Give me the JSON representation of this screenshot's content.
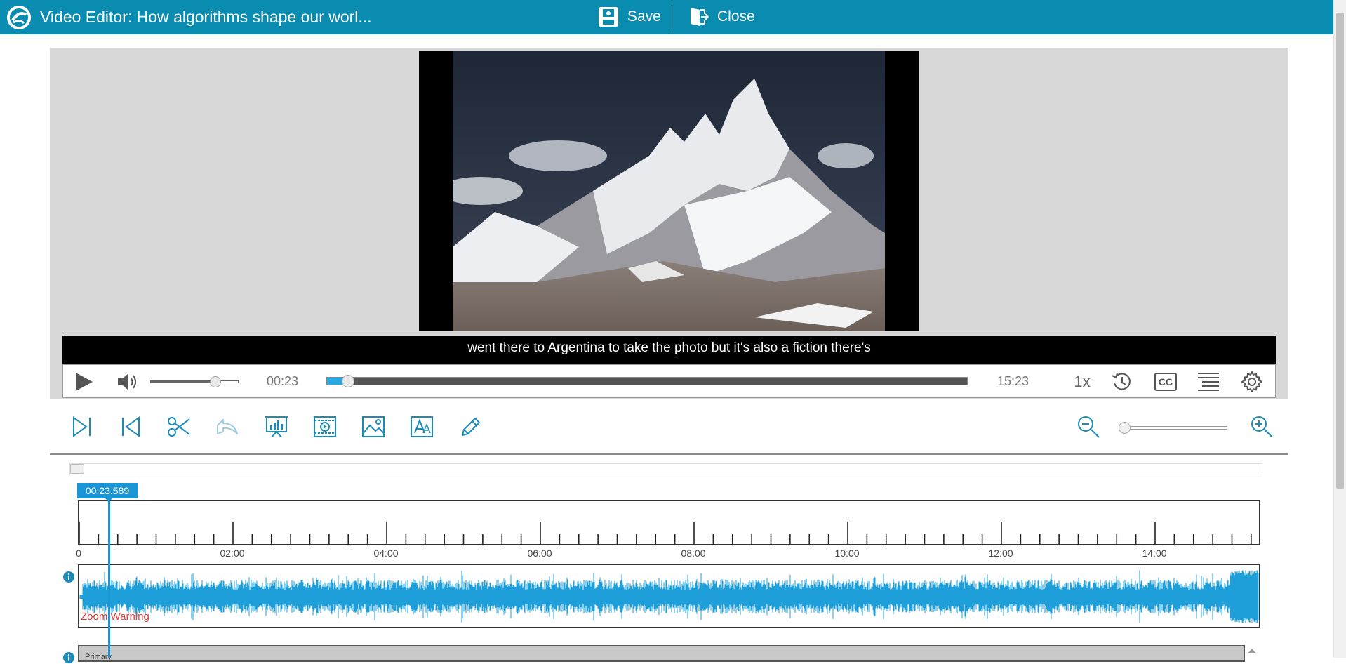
{
  "header": {
    "title": "Video Editor: How algorithms shape our worl...",
    "save_label": "Save",
    "close_label": "Close"
  },
  "player": {
    "caption": "went there to Argentina to take the photo but it's also a fiction there's",
    "current_time": "00:23",
    "duration": "15:23",
    "speed": "1x",
    "cc_label": "CC",
    "volume_level": 0.73,
    "progress_fraction": 0.025
  },
  "toolbar": {
    "icons": [
      "skip-to-end-icon",
      "skip-to-start-icon",
      "scissors-icon",
      "undo-icon",
      "chart-slide-icon",
      "video-clip-icon",
      "image-icon",
      "text-icon",
      "pencil-icon"
    ],
    "zoom_level": 0.0
  },
  "timeline": {
    "cursor_time": "00:23.589",
    "ruler_labels": [
      "0",
      "02:00",
      "04:00",
      "06:00",
      "08:00",
      "10:00",
      "12:00",
      "14:00"
    ],
    "zoom_warning": "Zoom Warning",
    "track2_label": "Primary"
  },
  "colors": {
    "header": "#0a8bb0",
    "accent": "#1a96d6",
    "waveform": "#1e9fda",
    "warning": "#e53935"
  }
}
